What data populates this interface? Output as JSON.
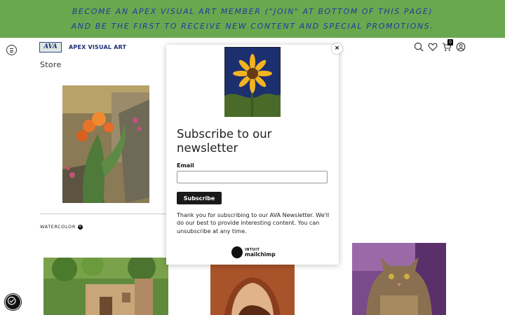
{
  "promo": {
    "line1": "BECOME AN APEX VISUAL ART MEMBER (\"JOIN\" AT BOTTOM OF THIS PAGE)",
    "line2": "AND BE THE FIRST TO RECEIVE NEW CONTENT AND SPECIAL PROMOTIONS."
  },
  "header": {
    "logo_mark": "AVA",
    "logo_text": "APEX VISUAL ART",
    "icons": [
      "menu-icon",
      "search-icon",
      "heart-icon",
      "cart-icon",
      "account-icon"
    ],
    "cart_count": "0"
  },
  "store": {
    "title": "Store",
    "category": "WATERCOLOR",
    "category_icon": "chevron-down-icon"
  },
  "modal": {
    "close_label": "×",
    "title": "Subscribe to our newsletter",
    "email_label": "Email",
    "email_value": "",
    "email_placeholder": "",
    "subscribe_label": "Subscribe",
    "thanks_text": "Thank you for subscribing to our AVA Newsletter. We'll do our best to provide interesting content. You can unsubscribe at any time.",
    "brand_top": "INTUIT",
    "brand_name": "mailchimp"
  },
  "colors": {
    "banner_bg": "#6aa84f",
    "banner_text": "#1f3a9e",
    "logo_blue": "#1e2f78",
    "button_bg": "#1a1a1a"
  }
}
